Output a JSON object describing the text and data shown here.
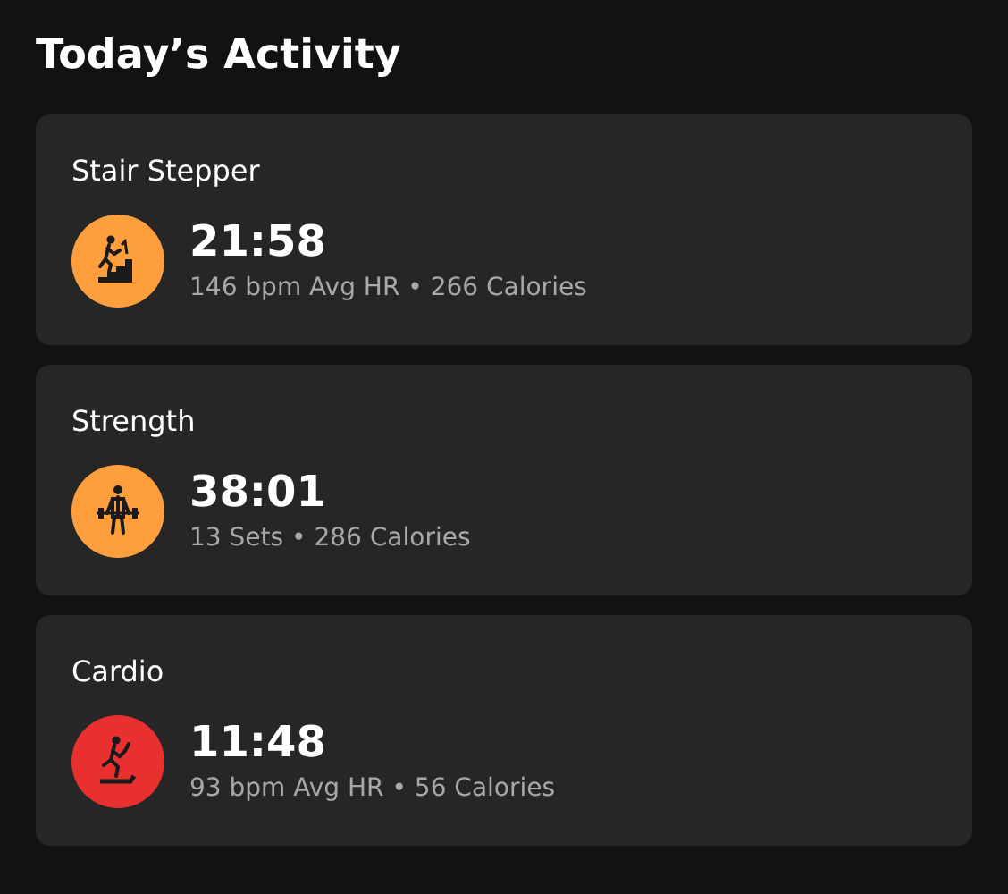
{
  "title": "Today’s Activity",
  "activities": [
    {
      "name": "Stair Stepper",
      "kind": "stairs",
      "color": "#ff9e3d",
      "duration": "21:58",
      "details": "146 bpm Avg HR • 266 Calories"
    },
    {
      "name": "Strength",
      "kind": "weights",
      "color": "#ff9e3d",
      "duration": "38:01",
      "details": "13 Sets • 286 Calories"
    },
    {
      "name": "Cardio",
      "kind": "treadmill",
      "color": "#e8312f",
      "duration": "11:48",
      "details": "93 bpm Avg HR • 56 Calories"
    }
  ]
}
